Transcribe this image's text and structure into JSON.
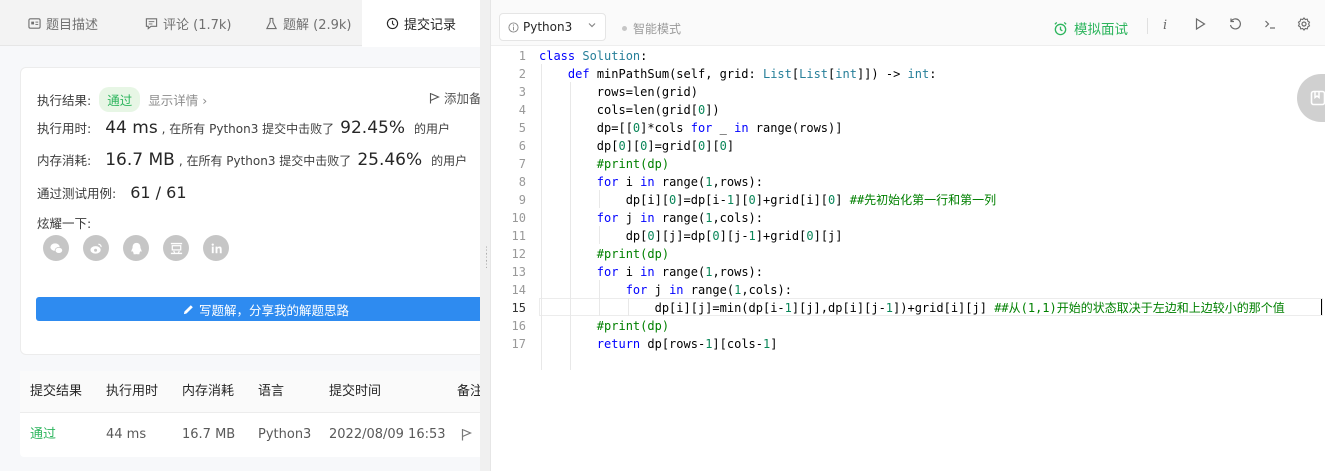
{
  "tabs": [
    {
      "label": "题目描述",
      "icon": "document-icon"
    },
    {
      "label": "评论 (1.7k)",
      "icon": "comment-icon"
    },
    {
      "label": "题解 (2.9k)",
      "icon": "flask-icon"
    },
    {
      "label": "提交记录",
      "icon": "clock-icon"
    }
  ],
  "result": {
    "status_label": "执行结果:",
    "status_value": "通过",
    "details_link": "显示详情 ›",
    "add_note": "添加备",
    "runtime_label": "执行用时:",
    "runtime_value": "44 ms",
    "runtime_text": ", 在所有 Python3 提交中击败了",
    "runtime_percent": "92.45%",
    "runtime_suffix": "的用户",
    "memory_label": "内存消耗:",
    "memory_value": "16.7 MB",
    "memory_text": ", 在所有 Python3 提交中击败了",
    "memory_percent": "25.46%",
    "memory_suffix": "的用户",
    "tests_label": "通过测试用例:",
    "tests_value": "61 / 61",
    "share_label": "炫耀一下:",
    "share_icons": [
      "wechat-icon",
      "weibo-icon",
      "qq-icon",
      "douban-icon",
      "linkedin-icon"
    ],
    "write_button": "写题解，分享我的解题思路"
  },
  "submissions": {
    "headers": [
      "提交结果",
      "执行用时",
      "内存消耗",
      "语言",
      "提交时间",
      "备注"
    ],
    "rows": [
      {
        "result": "通过",
        "runtime": "44 ms",
        "memory": "16.7 MB",
        "language": "Python3",
        "time": "2022/08/09 16:53"
      }
    ]
  },
  "toolbar": {
    "language": "Python3",
    "smart_mode": "智能模式",
    "mock_interview": "模拟面试",
    "accent_color": "#2db55d"
  },
  "code": {
    "current_line": 15,
    "lines": [
      "class Solution:",
      "    def minPathSum(self, grid: List[List[int]]) -> int:",
      "        rows=len(grid)",
      "        cols=len(grid[0])",
      "        dp=[[0]*cols for _ in range(rows)]",
      "        dp[0][0]=grid[0][0]",
      "        #print(dp)",
      "        for i in range(1,rows):",
      "            dp[i][0]=dp[i-1][0]+grid[i][0] ##先初始化第一行和第一列",
      "        for j in range(1,cols):",
      "            dp[0][j]=dp[0][j-1]+grid[0][j]",
      "        #print(dp)",
      "        for i in range(1,rows):",
      "            for j in range(1,cols):",
      "                dp[i][j]=min(dp[i-1][j],dp[i][j-1])+grid[i][j] ##从(1,1)开始的状态取决于左边和上边较小的那个值",
      "        #print(dp)",
      "        return dp[rows-1][cols-1]"
    ]
  }
}
